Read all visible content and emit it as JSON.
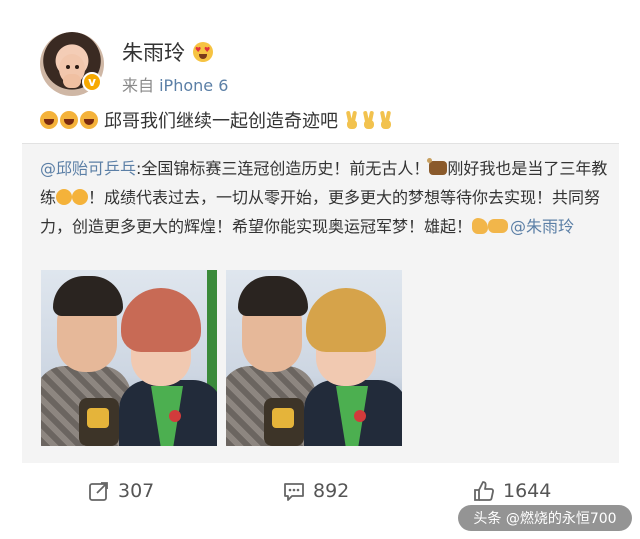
{
  "post": {
    "author": "朱雨玲",
    "source_prefix": "来自",
    "source_device": "iPhone 6",
    "text": "邱哥我们继续一起创造奇迹吧"
  },
  "repost": {
    "mention_author": "@邱贻可乒乓",
    "segment_1": ":全国锦标赛三连冠创造历史！前无古人！",
    "segment_2": "刚好我也是当了三年教练",
    "segment_3": "！成绩代表过去，一切从零开始，更多更大的梦想等待你去实现！共同努力，创造更多更大的辉煌！希望你能实现奥运冠军梦！雄起！",
    "mention_target": "@朱雨玲"
  },
  "actions": {
    "share_count": "307",
    "comment_count": "892",
    "like_count": "1644"
  },
  "watermark": "头条 @燃烧的永恒700",
  "icons": {
    "share": "share-icon",
    "comment": "comment-icon",
    "like": "thumbs-up-icon"
  },
  "colors": {
    "link": "#5b7fa6",
    "badge": "#f7a900",
    "repost_bg": "#f4f4f4"
  }
}
